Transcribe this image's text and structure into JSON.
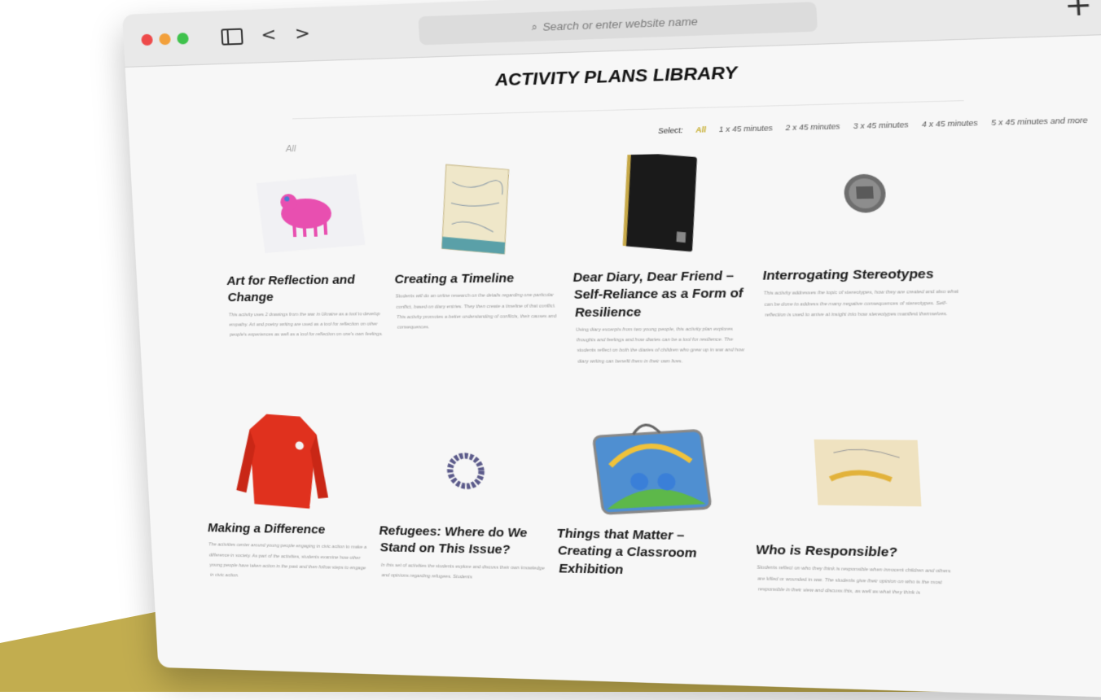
{
  "colors": {
    "accent": "#c7ae2f",
    "olive": "#c2ad4f"
  },
  "browser": {
    "search_placeholder": "Search or enter website name",
    "back_label": "<",
    "forward_label": ">",
    "new_tab_label": "+"
  },
  "page": {
    "title": "ACTIVITY PLANS LIBRARY",
    "all_left": "All",
    "filters": {
      "select_label": "Select:",
      "options": [
        "All",
        "1 x 45 minutes",
        "2 x 45 minutes",
        "3 x 45 minutes",
        "4 x 45 minutes",
        "5 x 45 minutes and more"
      ]
    }
  },
  "cards": [
    {
      "title": "Art for Reflection and Change",
      "image": "pink-pig-drawing",
      "excerpt": "This activity uses 2 drawings from the war in Ukraine as a tool to develop empathy. Art and poetry writing are used as a tool for reflection on other people's experiences as well as a tool for reflection on one's own feelings."
    },
    {
      "title": "Creating a Timeline",
      "image": "notebook-map",
      "excerpt": "Students will do an online research on the details regarding one particular conflict, based on diary entries. They then create a timeline of that conflict. This activity promotes a better understanding of conflicts, their causes and consequences."
    },
    {
      "title": "Dear Diary, Dear Friend – Self-Reliance as a Form of Resilience",
      "image": "black-diary",
      "excerpt": "Using diary excerpts from two young people, this activity plan explores thoughts and feelings and how diaries can be a tool for resilience. The students reflect on both the diaries of children who grew up in war and how diary writing can benefit them in their own lives."
    },
    {
      "title": "Interrogating Stereotypes",
      "image": "coin",
      "excerpt": "This activity addresses the topic of stereotypes, how they are created and also what can be done to address the many negative consequences of stereotypes. Self-reflection is used to arrive at insight into how stereotypes manifest themselves."
    },
    {
      "title": "Making a Difference",
      "image": "red-sweater",
      "excerpt": "The activities center around young people engaging in civic action to make a difference in society. As part of the activities, students examine how other young people have taken action in the past and then follow steps to engage in civic action."
    },
    {
      "title": "Refugees: Where do We Stand on This Issue?",
      "image": "bead-bracelet",
      "excerpt": "In this set of activities the students explore and discuss their own knowledge and opinions regarding refugees. Students"
    },
    {
      "title": "Things that Matter – Creating a Classroom Exhibition",
      "image": "smurf-suitcase",
      "excerpt": ""
    },
    {
      "title": "Who is Responsible?",
      "image": "child-drawing",
      "excerpt": "Students reflect on who they think is responsible when innocent children and others are killed or wounded in war. The students give their opinion on who is the most responsible in their view and discuss this, as well as what they think is"
    }
  ]
}
